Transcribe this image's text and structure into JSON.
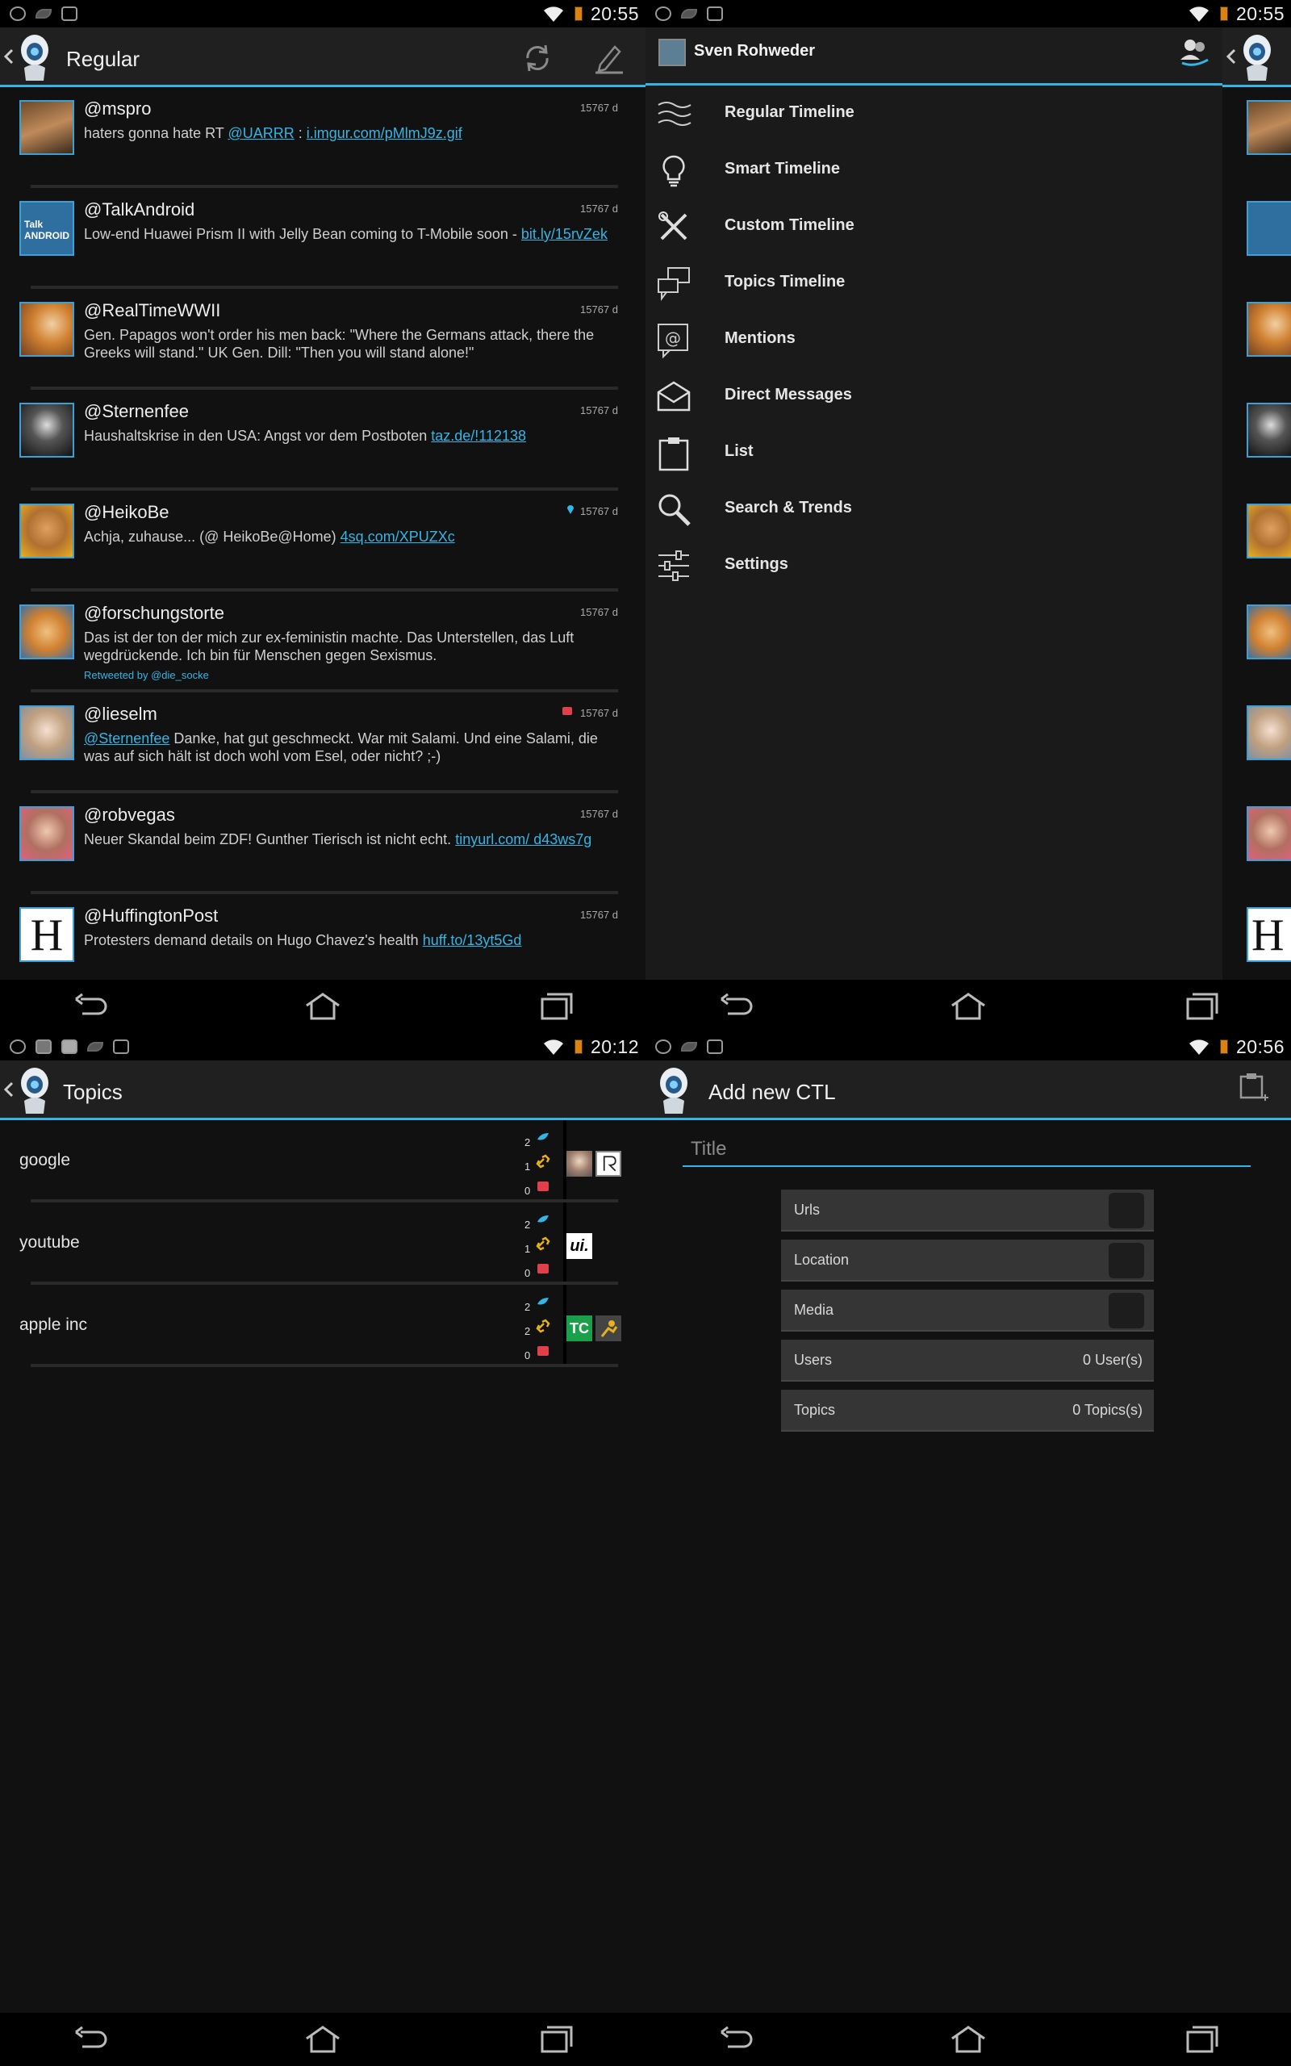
{
  "colors": {
    "accent": "#33b5e5",
    "background": "#111111",
    "actionbar": "#202020"
  },
  "screen1": {
    "status_time": "20:55",
    "title": "Regular",
    "tweets": [
      {
        "user": "@mspro",
        "age": "15767 d",
        "text": "haters gonna hate RT ",
        "link1": "@UARRR",
        "mid": " : ",
        "link2": "i.imgur.com/pMlmJ9z.gif",
        "retweet": ""
      },
      {
        "user": "@TalkAndroid",
        "age": "15767 d",
        "text": "Low-end Huawei Prism II with Jelly Bean coming to T-Mobile soon - ",
        "link1": "bit.ly/15rvZek",
        "mid": "",
        "link2": "",
        "retweet": ""
      },
      {
        "user": "@RealTimeWWII",
        "age": "15767 d",
        "text": "Gen. Papagos won't order his men back: \"Where the Germans attack, there the Greeks will stand.\" UK Gen. Dill: \"Then you will stand alone!\"",
        "link1": "",
        "mid": "",
        "link2": "",
        "retweet": ""
      },
      {
        "user": "@Sternenfee",
        "age": "15767 d",
        "text": "Haushaltskrise in den USA: Angst vor dem Postboten ",
        "link1": "taz.de/!112138",
        "mid": "",
        "link2": "",
        "retweet": ""
      },
      {
        "user": "@HeikoBe",
        "age": "15767 d",
        "text": "Achja, zuhause... (@ HeikoBe@Home) ",
        "link1": "4sq.com/XPUZXc",
        "mid": "",
        "link2": "",
        "retweet": ""
      },
      {
        "user": "@forschungstorte",
        "age": "15767 d",
        "text": "Das ist der ton der mich zur ex-feministin machte. Das Unterstellen, das Luft wegdrückende. Ich bin für Menschen gegen Sexismus.",
        "link1": "",
        "mid": "",
        "link2": "",
        "retweet": "Retweeted by @die_socke"
      },
      {
        "user": "@lieselm",
        "age": "15767 d",
        "text": "",
        "link1": "@Sternenfee",
        "mid": " Danke, hat gut geschmeckt. War mit Salami. Und eine Salami, die was auf sich hält ist doch wohl vom Esel, oder nicht? ;-)",
        "link2": "",
        "retweet": ""
      },
      {
        "user": "@robvegas",
        "age": "15767 d",
        "text": "Neuer Skandal beim ZDF! Gunther Tierisch ist nicht echt. ",
        "link1": "tinyurl.com/ d43ws7g",
        "mid": "",
        "link2": "",
        "retweet": ""
      },
      {
        "user": "@HuffingtonPost",
        "age": "15767 d",
        "text": "Protesters demand details on Hugo Chavez's health ",
        "link1": "huff.to/13yt5Gd",
        "mid": "",
        "link2": "",
        "retweet": ""
      }
    ]
  },
  "screen2": {
    "status_time": "20:55",
    "account_name": "Sven Rohweder",
    "menu": [
      {
        "label": "Regular Timeline",
        "icon": "waves-icon"
      },
      {
        "label": "Smart Timeline",
        "icon": "lightbulb-icon"
      },
      {
        "label": "Custom Timeline",
        "icon": "tools-icon"
      },
      {
        "label": "Topics Timeline",
        "icon": "chat-bubbles-icon"
      },
      {
        "label": "Mentions",
        "icon": "at-icon"
      },
      {
        "label": "Direct Messages",
        "icon": "envelope-icon"
      },
      {
        "label": "List",
        "icon": "clipboard-icon"
      },
      {
        "label": "Search & Trends",
        "icon": "search-icon"
      },
      {
        "label": "Settings",
        "icon": "sliders-icon"
      }
    ]
  },
  "screen3": {
    "status_time": "20:12",
    "title": "Topics",
    "topics": [
      {
        "name": "google",
        "tweets": "2",
        "links": "1",
        "media": "0"
      },
      {
        "name": "youtube",
        "tweets": "2",
        "links": "1",
        "media": "0"
      },
      {
        "name": "apple inc",
        "tweets": "2",
        "links": "2",
        "media": "0"
      }
    ]
  },
  "screen4": {
    "status_time": "20:56",
    "title": "Add new CTL",
    "title_placeholder": "Title",
    "options": [
      {
        "label": "Urls",
        "value": ""
      },
      {
        "label": "Location",
        "value": ""
      },
      {
        "label": "Media",
        "value": ""
      },
      {
        "label": "Users",
        "value": "0 User(s)"
      },
      {
        "label": "Topics",
        "value": "0 Topics(s)"
      }
    ]
  }
}
